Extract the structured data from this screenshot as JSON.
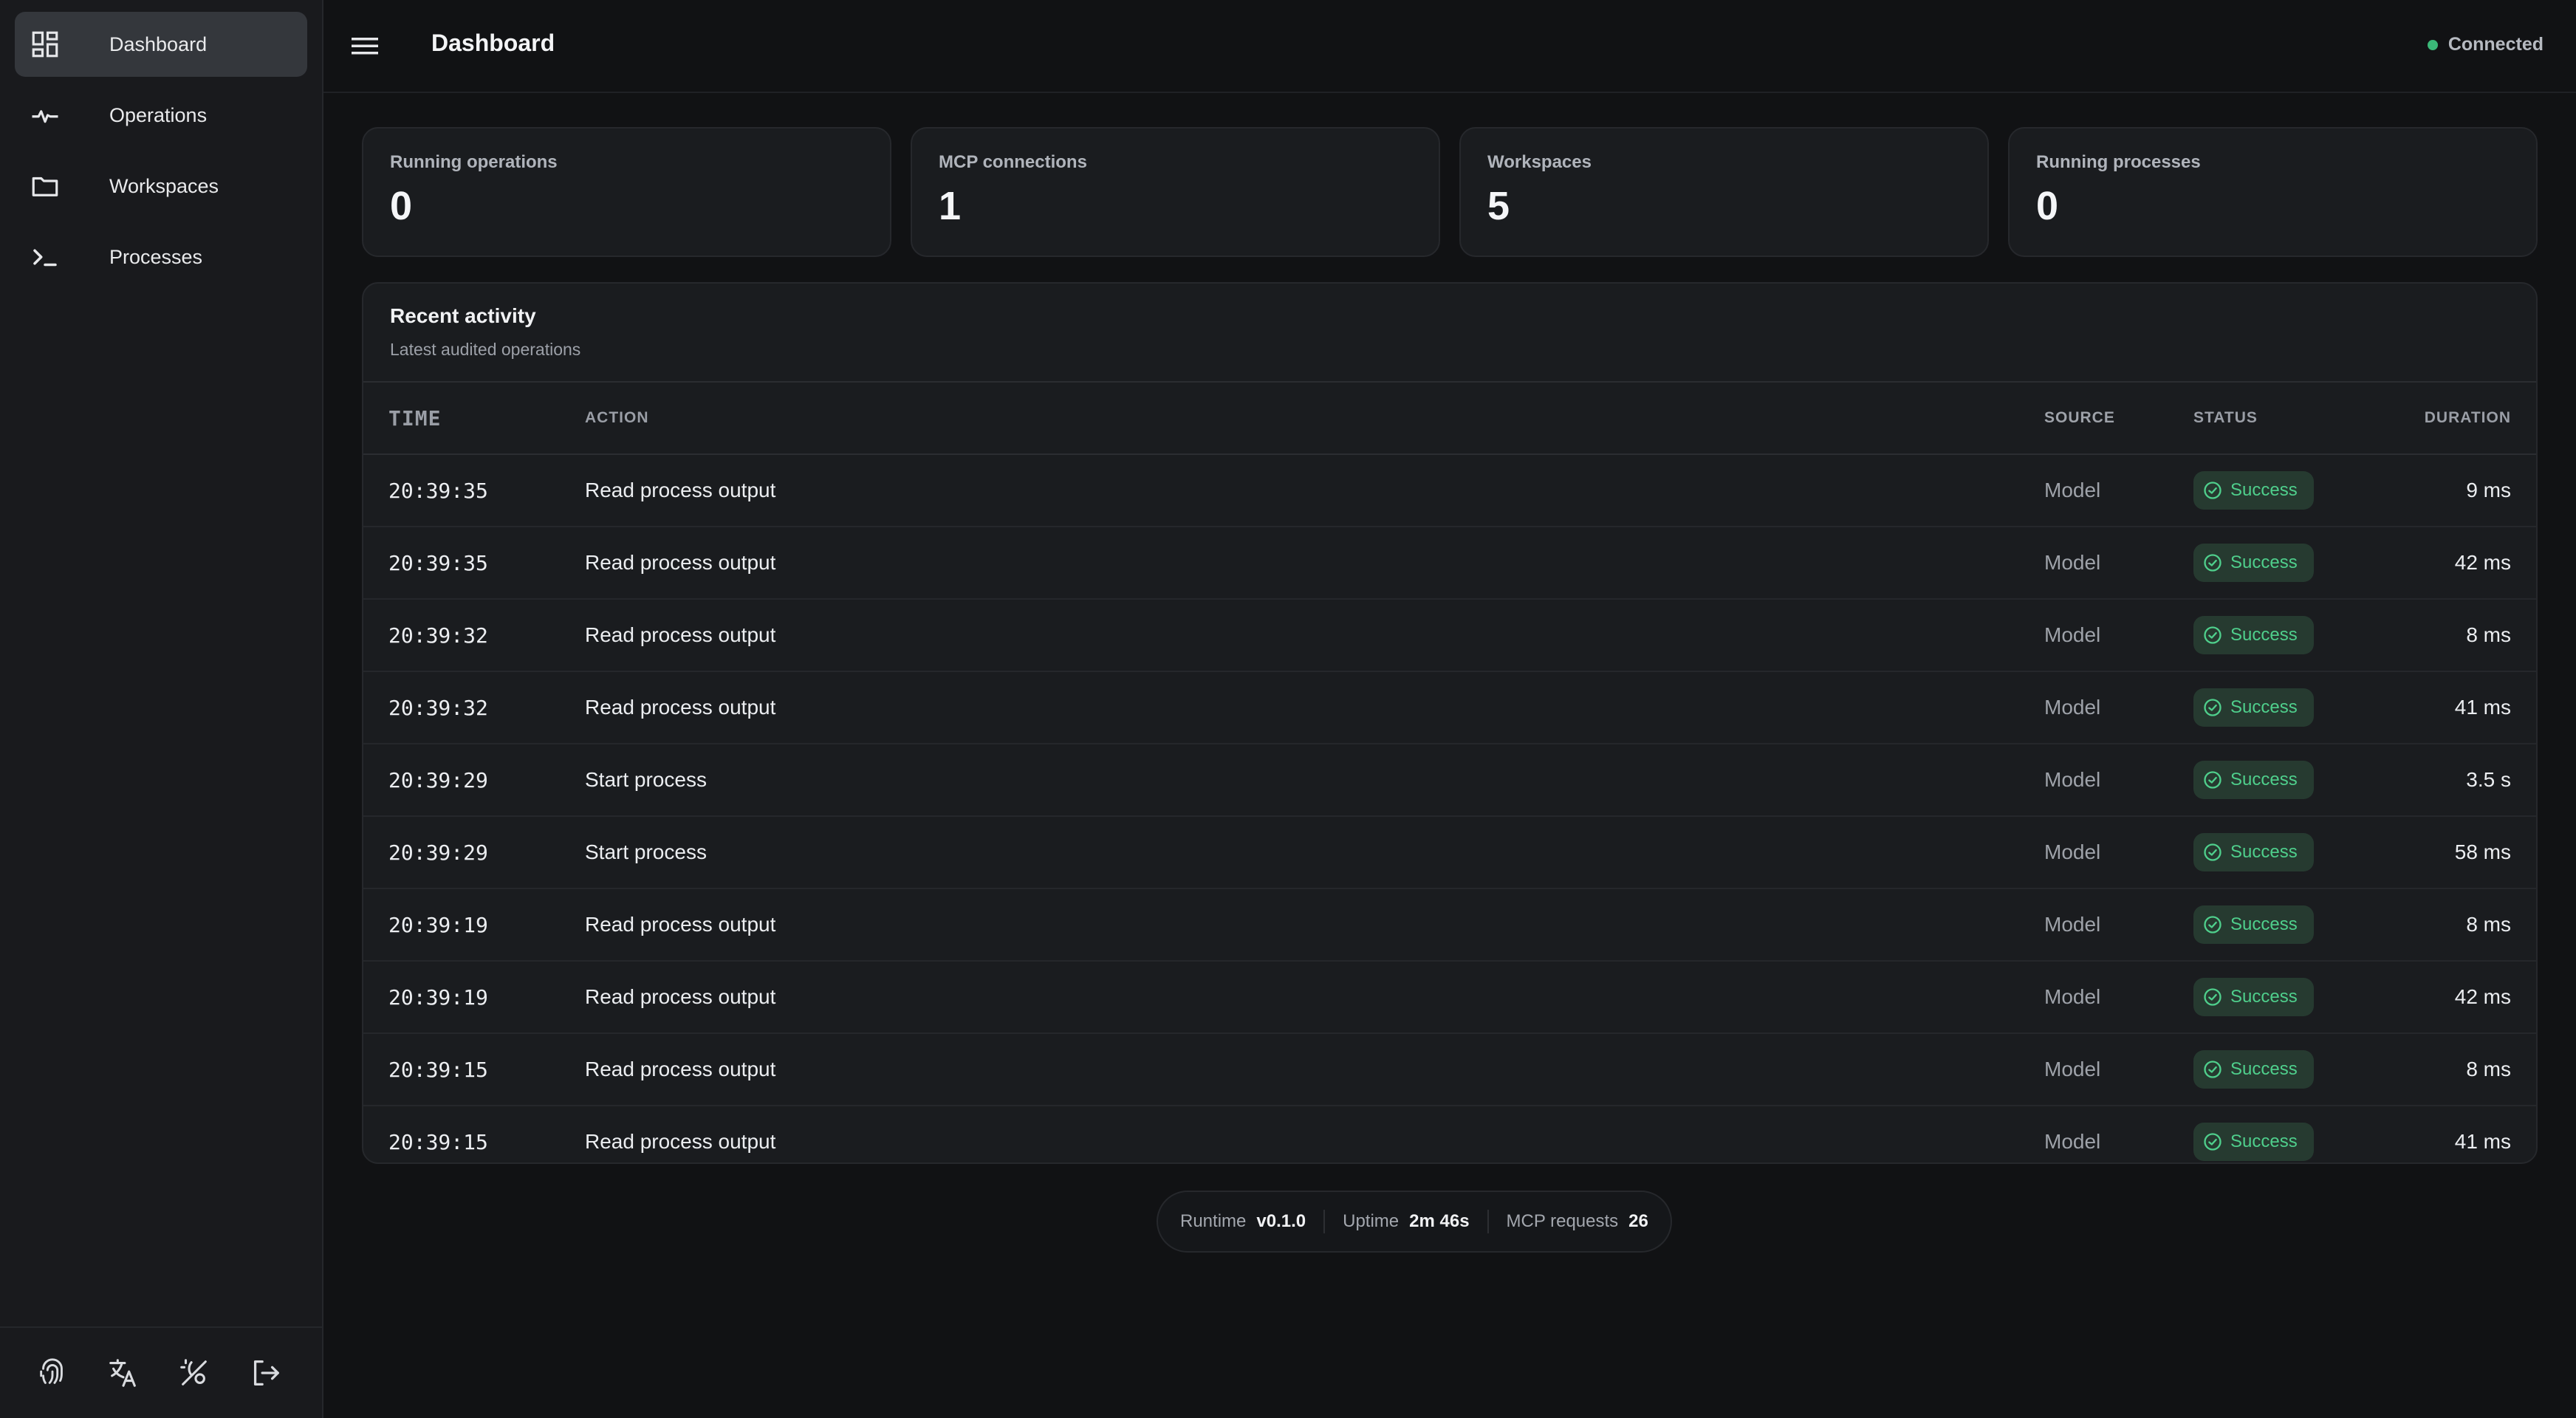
{
  "sidebar": {
    "items": [
      {
        "label": "Dashboard",
        "icon": "dashboard-icon",
        "active": true
      },
      {
        "label": "Operations",
        "icon": "activity-pulse-icon",
        "active": false
      },
      {
        "label": "Workspaces",
        "icon": "folder-icon",
        "active": false
      },
      {
        "label": "Processes",
        "icon": "terminal-icon",
        "active": false
      }
    ],
    "footer_icons": [
      "fingerprint-icon",
      "translate-icon",
      "theme-toggle-icon",
      "logout-icon"
    ]
  },
  "header": {
    "title": "Dashboard",
    "connection_status": "Connected",
    "connection_color": "#3bb878"
  },
  "stats": [
    {
      "label": "Running operations",
      "value": "0"
    },
    {
      "label": "MCP connections",
      "value": "1"
    },
    {
      "label": "Workspaces",
      "value": "5"
    },
    {
      "label": "Running processes",
      "value": "0"
    }
  ],
  "activity": {
    "title": "Recent activity",
    "subtitle": "Latest audited operations",
    "columns": {
      "time": "TIME",
      "action": "ACTION",
      "source": "SOURCE",
      "status": "STATUS",
      "duration": "DURATION"
    },
    "rows": [
      {
        "time": "20:39:35",
        "action": "Read process output",
        "source": "Model",
        "status": "Success",
        "duration": "9 ms"
      },
      {
        "time": "20:39:35",
        "action": "Read process output",
        "source": "Model",
        "status": "Success",
        "duration": "42 ms"
      },
      {
        "time": "20:39:32",
        "action": "Read process output",
        "source": "Model",
        "status": "Success",
        "duration": "8 ms"
      },
      {
        "time": "20:39:32",
        "action": "Read process output",
        "source": "Model",
        "status": "Success",
        "duration": "41 ms"
      },
      {
        "time": "20:39:29",
        "action": "Start process",
        "source": "Model",
        "status": "Success",
        "duration": "3.5 s"
      },
      {
        "time": "20:39:29",
        "action": "Start process",
        "source": "Model",
        "status": "Success",
        "duration": "58 ms"
      },
      {
        "time": "20:39:19",
        "action": "Read process output",
        "source": "Model",
        "status": "Success",
        "duration": "8 ms"
      },
      {
        "time": "20:39:19",
        "action": "Read process output",
        "source": "Model",
        "status": "Success",
        "duration": "42 ms"
      },
      {
        "time": "20:39:15",
        "action": "Read process output",
        "source": "Model",
        "status": "Success",
        "duration": "8 ms"
      },
      {
        "time": "20:39:15",
        "action": "Read process output",
        "source": "Model",
        "status": "Success",
        "duration": "41 ms"
      }
    ],
    "success_color": "#4fcf8c"
  },
  "footer": {
    "runtime_label": "Runtime",
    "runtime_value": "v0.1.0",
    "uptime_label": "Uptime",
    "uptime_value": "2m 46s",
    "requests_label": "MCP requests",
    "requests_value": "26"
  }
}
